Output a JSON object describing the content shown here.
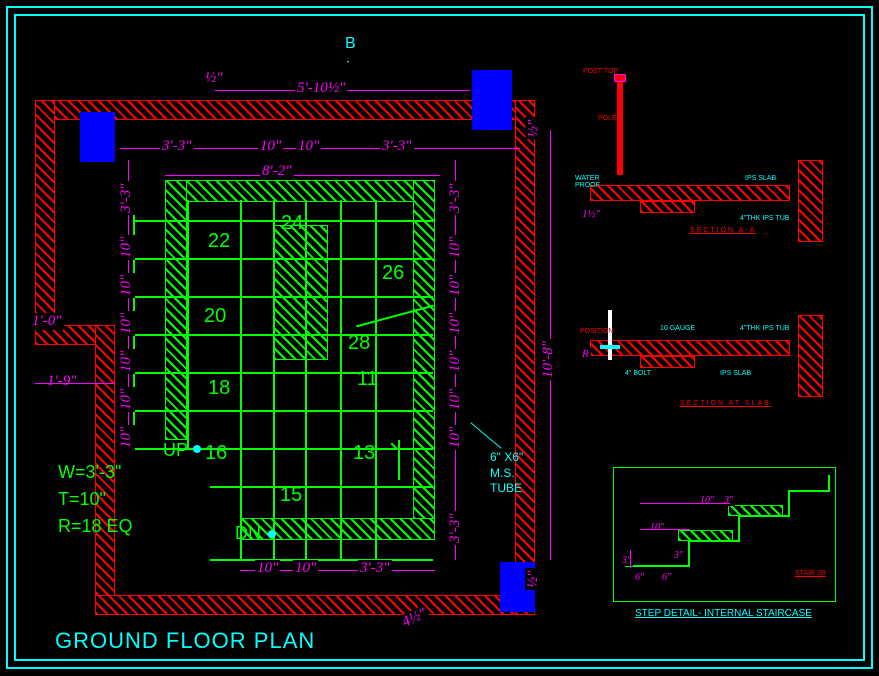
{
  "title": "GROUND FLOOR PLAN",
  "grid_label": "B",
  "dimensions": {
    "top_span": "5'-10½\"",
    "small_tick": "½\"",
    "h_left": "3'-3\"",
    "h_mid1": "10\"",
    "h_mid2": "10\"",
    "h_right": "3'-3\"",
    "overall_w": "8'-2\"",
    "v_top": "3'-3\"",
    "v_bot": "3'-3\"",
    "v_step": "10\"",
    "v_right_total": "10'-8\"",
    "v_right_tick": "½\"",
    "left_ext1": "1'-0\"",
    "left_ext2": "1'-9\"",
    "bot_mid1": "10\"",
    "bot_mid2": "10\"",
    "bot_right": "3'-3\"",
    "angle_dim": "4½\""
  },
  "steps": [
    "16",
    "18",
    "20",
    "22",
    "24",
    "26",
    "28",
    "11",
    "13",
    "15"
  ],
  "labels": {
    "up": "UP",
    "dn": "DN"
  },
  "info": {
    "w": "W=3'-3\"",
    "t": "T=10\"",
    "r": "R=18 EQ"
  },
  "notes": {
    "tube": "6\" X6\"\nM.S.\nTUBE"
  },
  "detail": {
    "sec1": "SECTION A-A",
    "sec2": "SECTION AT SLAB",
    "step_title": "STEP DETAIL- INTERNAL STAIRCASE",
    "slab_dim": "1½\"",
    "r_label": "R",
    "step_d1": "10\"",
    "step_d2": "3\"",
    "step_d3": "10\"",
    "step_d4": "6\"",
    "step_d5": "3\"",
    "step_d6": "6\""
  },
  "chart_data": {
    "type": "diagram",
    "drawing_type": "architectural_floor_plan",
    "view": "Ground Floor Plan — internal staircase",
    "grid_references": [
      "B"
    ],
    "staircase": {
      "width": "3'-3\"",
      "tread": "10\"",
      "risers": "18 EQ",
      "step_numbers_visible": [
        11,
        13,
        15,
        16,
        18,
        20,
        22,
        24,
        26,
        28
      ],
      "direction_labels": [
        "UP",
        "DN"
      ],
      "structural_member": "6\"x6\" M.S. TUBE"
    },
    "plan_dimensions": {
      "horizontal": [
        "3'-3\"",
        "10\"",
        "10\"",
        "3'-3\""
      ],
      "horizontal_overall": "8'-2\"",
      "top_clear": "5'-10½\"",
      "vertical_left": [
        "3'-3\"",
        "10\"",
        "10\"",
        "10\"",
        "10\"",
        "10\"",
        "10\""
      ],
      "vertical_right": [
        "3'-3\"",
        "10\"",
        "10\"",
        "10\"",
        "10\"",
        "10\"",
        "10\"",
        "3'-3\""
      ],
      "vertical_right_overall": "10'-8\"",
      "wall_extensions_left": [
        "1'-0\"",
        "1'-9\""
      ],
      "wall_offsets": [
        "½\"",
        "4½\""
      ]
    },
    "details": [
      {
        "name": "SECTION A-A",
        "slab_thickness": "1½\""
      },
      {
        "name": "SECTION AT SLAB"
      },
      {
        "name": "STEP DETAIL- INTERNAL STAIRCASE",
        "tread": "10\"",
        "riser": "6\"",
        "nosing": "3\""
      }
    ],
    "colors": {
      "walls": "#FF0000",
      "stair": "#00FF00",
      "columns": "#0000FF",
      "dimensions": "#FF00FF",
      "frame_title": "#00FFFF",
      "background": "#000000"
    }
  }
}
